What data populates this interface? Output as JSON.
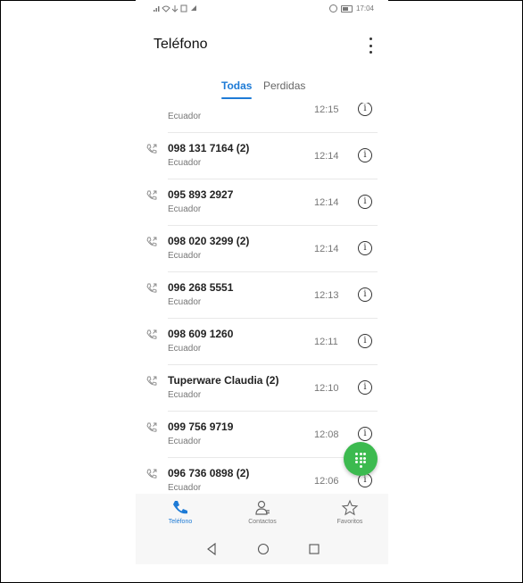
{
  "statusbar": {
    "left_icons": "∙∙∙",
    "time": "17:04"
  },
  "appbar": {
    "title": "Teléfono",
    "menu_icon": "more-vert-icon"
  },
  "tabs": [
    {
      "label": "Todas",
      "active": true
    },
    {
      "label": "Perdidas",
      "active": false
    }
  ],
  "calls": [
    {
      "name": "",
      "location": "Ecuador",
      "time": "12:15"
    },
    {
      "name": "098 131 7164 (2)",
      "location": "Ecuador",
      "time": "12:14"
    },
    {
      "name": "095 893 2927",
      "location": "Ecuador",
      "time": "12:14"
    },
    {
      "name": "098 020 3299 (2)",
      "location": "Ecuador",
      "time": "12:14"
    },
    {
      "name": "096 268 5551",
      "location": "Ecuador",
      "time": "12:13"
    },
    {
      "name": "098 609 1260",
      "location": "Ecuador",
      "time": "12:11"
    },
    {
      "name": "Tuperware Claudia (2)",
      "location": "Ecuador",
      "time": "12:10"
    },
    {
      "name": "099 756 9719",
      "location": "Ecuador",
      "time": "12:08"
    },
    {
      "name": "096 736 0898 (2)",
      "location": "Ecuador",
      "time": "12:06"
    }
  ],
  "bottom_nav": [
    {
      "label": "Teléfono",
      "icon": "phone-icon",
      "active": true
    },
    {
      "label": "Contactos",
      "icon": "contacts-icon",
      "active": false
    },
    {
      "label": "Favoritos",
      "icon": "star-icon",
      "active": false
    }
  ],
  "colors": {
    "accent": "#1e7bd6",
    "fab": "#3cba4f"
  }
}
